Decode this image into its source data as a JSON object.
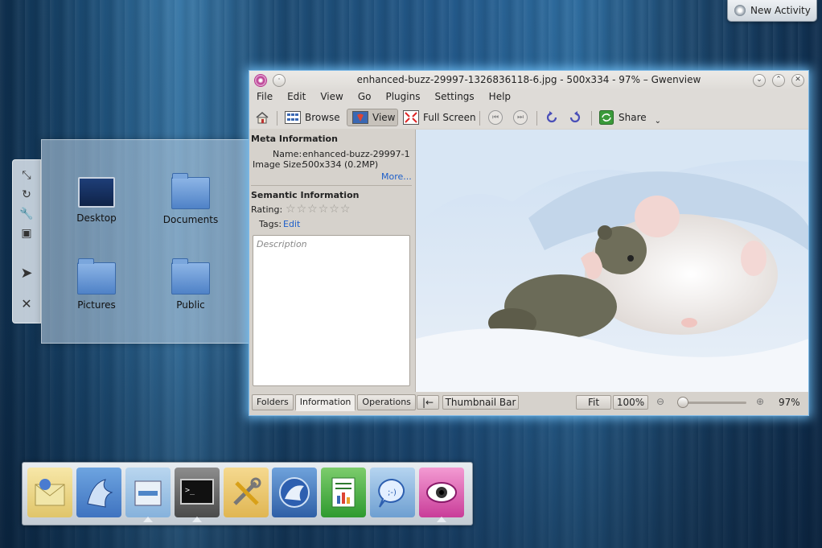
{
  "desktop": {
    "new_activity_label": "New Activity",
    "folder_items": [
      {
        "label": "Desktop",
        "icon": "desktop-folder-icon"
      },
      {
        "label": "Documents",
        "icon": "folder-icon"
      },
      {
        "label": "Pictures",
        "icon": "folder-icon"
      },
      {
        "label": "Public",
        "icon": "folder-icon"
      }
    ]
  },
  "window": {
    "title": "enhanced-buzz-29997-1326836118-6.jpg - 500x334 - 97% – Gwenview",
    "menu": [
      "File",
      "Edit",
      "View",
      "Go",
      "Plugins",
      "Settings",
      "Help"
    ],
    "toolbar": {
      "browse_label": "Browse",
      "view_label": "View",
      "fullscreen_label": "Full Screen",
      "share_label": "Share"
    },
    "meta": {
      "header": "Meta Information",
      "name_label": "Name:",
      "name_value": "enhanced-buzz-29997-1326836118-6.jpg",
      "size_label": "Image Size:",
      "size_value": "500x334 (0.2MP)",
      "more_link": "More..."
    },
    "semantic": {
      "header": "Semantic Information",
      "rating_label": "Rating:",
      "rating_value": 0,
      "rating_max": 6,
      "tags_label": "Tags:",
      "tags_link": "Edit",
      "description_placeholder": "Description"
    },
    "side_tabs": [
      "Folders",
      "Information",
      "Operations"
    ],
    "side_tab_selected": "Information",
    "statusbar": {
      "thumbnail_bar_label": "Thumbnail Bar",
      "fit_label": "Fit",
      "zoom_100_label": "100%",
      "zoom_value": "97%"
    }
  },
  "taskbar": {
    "apps": [
      "mail-app",
      "kde-app",
      "file-manager",
      "terminal",
      "system-settings",
      "browser",
      "spreadsheet",
      "chat",
      "gwenview"
    ]
  },
  "colors": {
    "accent_glow": "#7fb9e6",
    "link": "#1d5ec9"
  }
}
